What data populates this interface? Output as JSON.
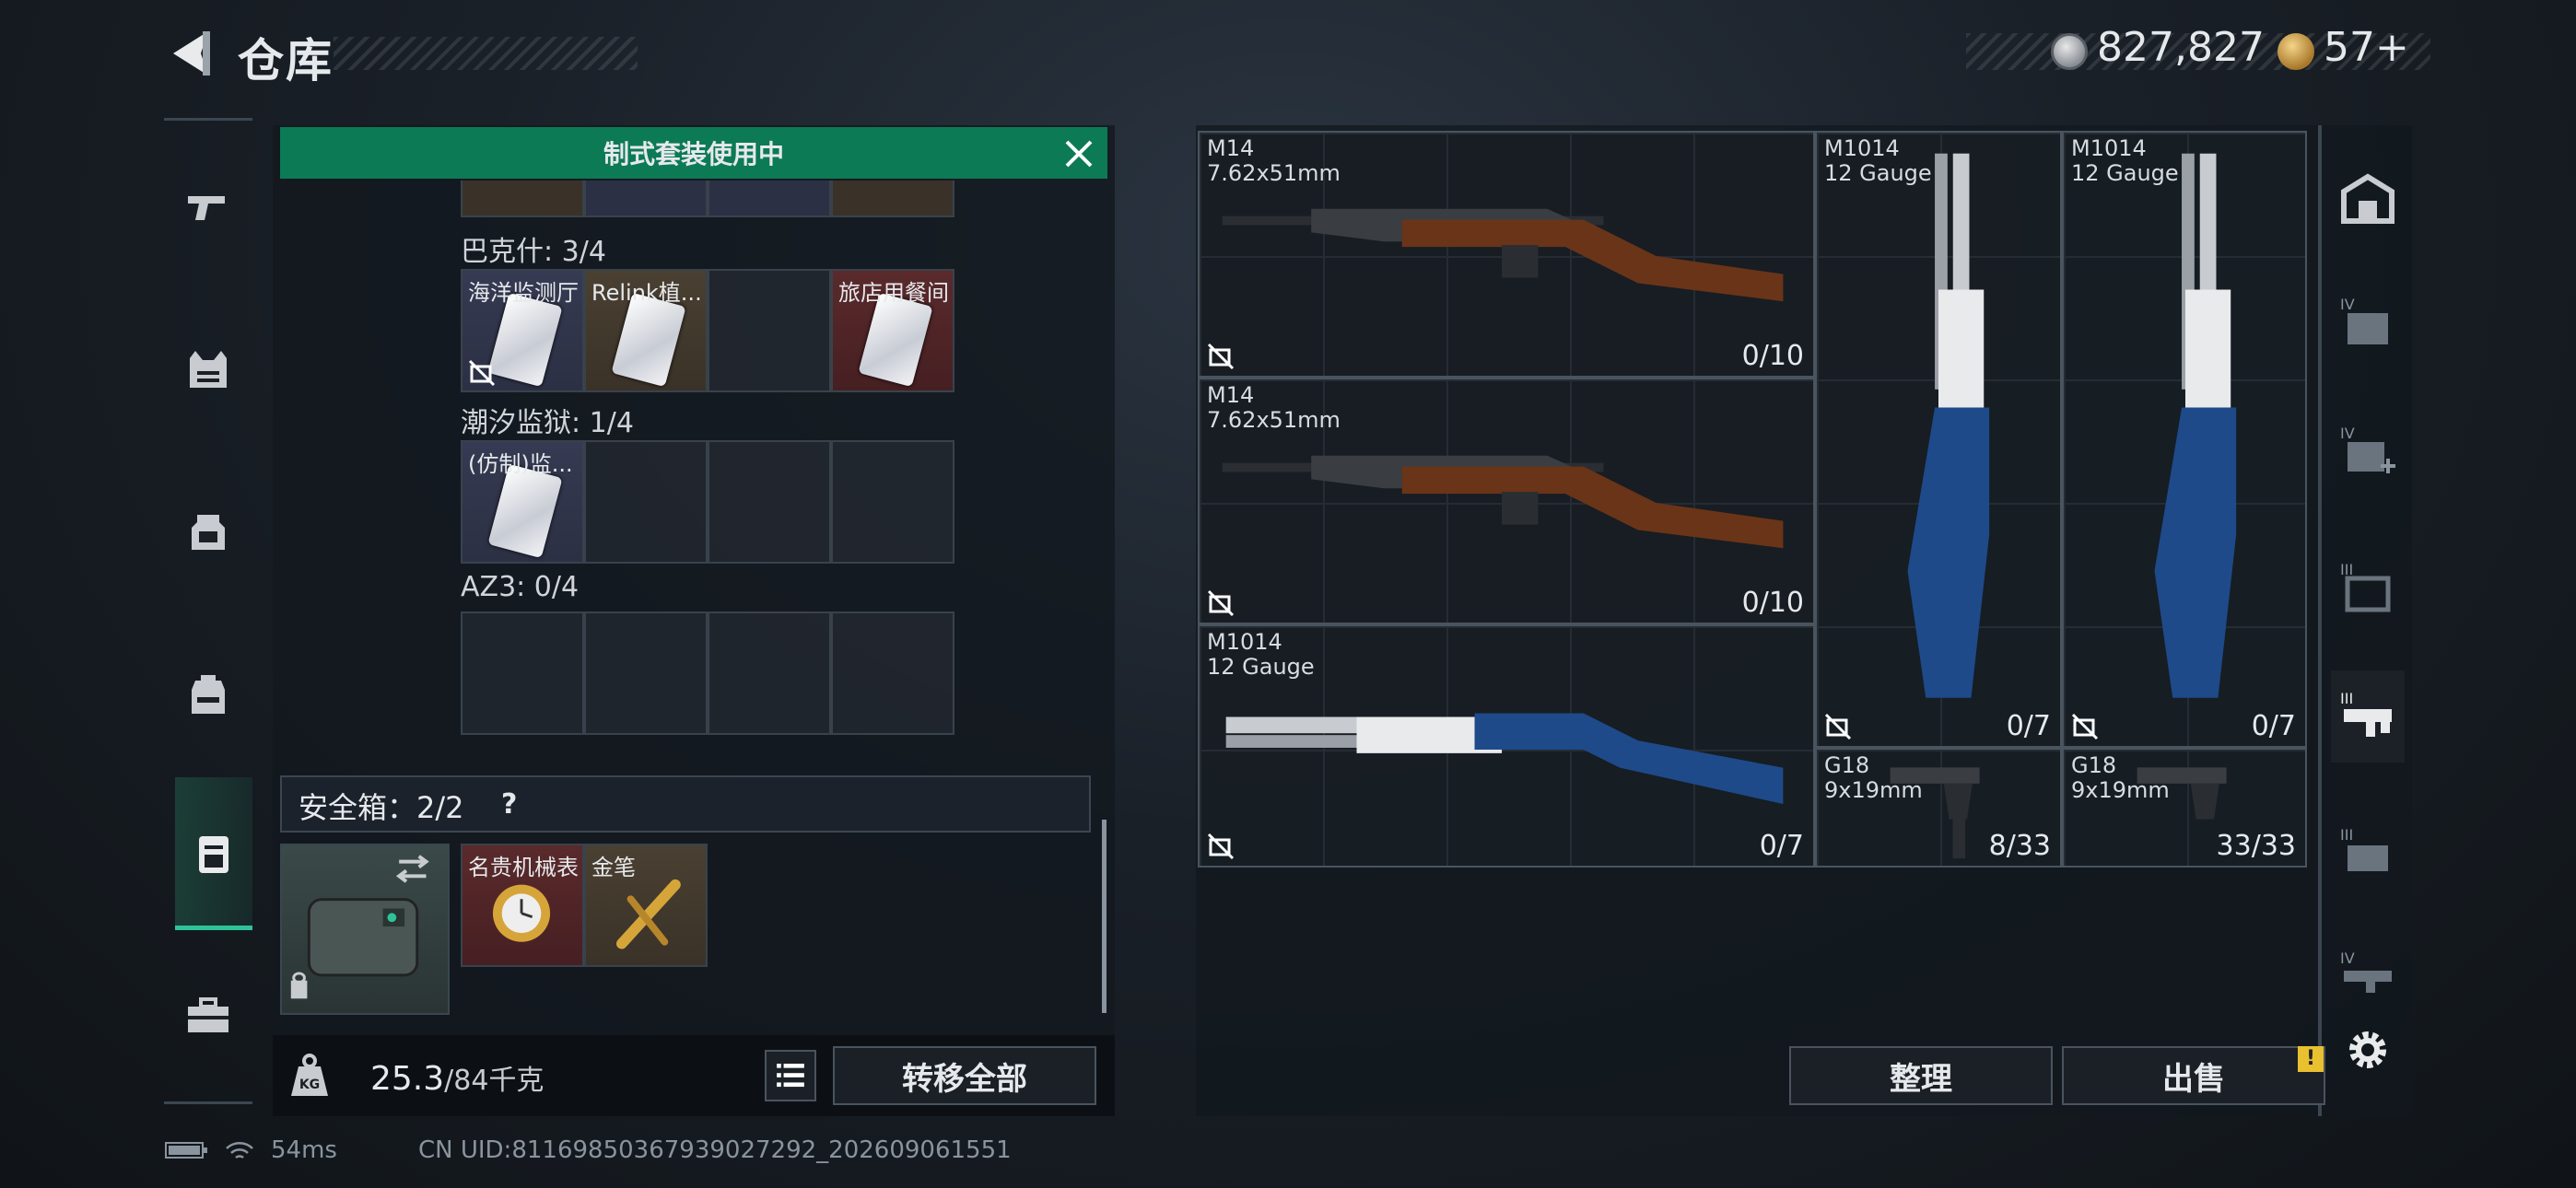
{
  "header": {
    "title": "仓库",
    "currency": [
      {
        "icon": "silver-coin-icon",
        "value": "827,827"
      },
      {
        "icon": "gold-medal-icon",
        "value": "57+"
      }
    ]
  },
  "banner": {
    "text": "制式套装使用中"
  },
  "sections": [
    {
      "label": "巴克什: 3/4",
      "slots": [
        {
          "name": "海洋监测厅",
          "color": "purple",
          "nouse": true
        },
        {
          "name": "Relink植...",
          "color": "gold",
          "nouse": false
        },
        {
          "name": "",
          "color": "empty",
          "nouse": false
        },
        {
          "name": "旅店用餐间",
          "color": "red",
          "nouse": false
        }
      ]
    },
    {
      "label": "潮汐监狱: 1/4",
      "slots": [
        {
          "name": "(仿制)监...",
          "color": "purple",
          "nouse": false
        },
        {
          "name": "",
          "color": "empty"
        },
        {
          "name": "",
          "color": "empty"
        },
        {
          "name": "",
          "color": "empty"
        }
      ]
    },
    {
      "label": "AZ3: 0/4",
      "slots": [
        {
          "name": "",
          "color": "empty"
        },
        {
          "name": "",
          "color": "empty"
        },
        {
          "name": "",
          "color": "empty"
        },
        {
          "name": "",
          "color": "empty"
        }
      ]
    }
  ],
  "safe": {
    "label": "安全箱：2/2",
    "help": "?",
    "items": [
      {
        "name": "名贵机械表",
        "color": "red"
      },
      {
        "name": "金笔",
        "color": "gold"
      }
    ]
  },
  "weight": {
    "current": "25.3",
    "max": "/84千克"
  },
  "buttons": {
    "transfer": "转移全部",
    "sort": "整理",
    "sell": "出售",
    "sell_badge": "!"
  },
  "stash": [
    {
      "name": "M14",
      "caliber": "7.62x51mm",
      "count": "0/10"
    },
    {
      "name": "M14",
      "caliber": "7.62x51mm",
      "count": "0/10"
    },
    {
      "name": "M1014",
      "caliber": "12 Gauge",
      "count": "0/7"
    },
    {
      "name": "M1014",
      "caliber": "12 Gauge",
      "count": "0/7"
    },
    {
      "name": "M1014",
      "caliber": "12 Gauge",
      "count": "0/7"
    },
    {
      "name": "G18",
      "caliber": "9x19mm",
      "count": "8/33"
    },
    {
      "name": "G18",
      "caliber": "9x19mm",
      "count": "33/33"
    }
  ],
  "right_tabs": [
    {
      "icon": "container-icon",
      "tier": ""
    },
    {
      "icon": "folder-icon",
      "tier": "IV"
    },
    {
      "icon": "medkit-icon",
      "tier": "IV"
    },
    {
      "icon": "armor-icon",
      "tier": "III"
    },
    {
      "icon": "rifle-case-icon",
      "tier": "III"
    },
    {
      "icon": "ammo-box-icon",
      "tier": "III"
    },
    {
      "icon": "weapon-case-icon",
      "tier": "IV"
    }
  ],
  "status": {
    "ping": "54ms",
    "uid": "CN UID:8116985036793902729​2_202609061551"
  }
}
